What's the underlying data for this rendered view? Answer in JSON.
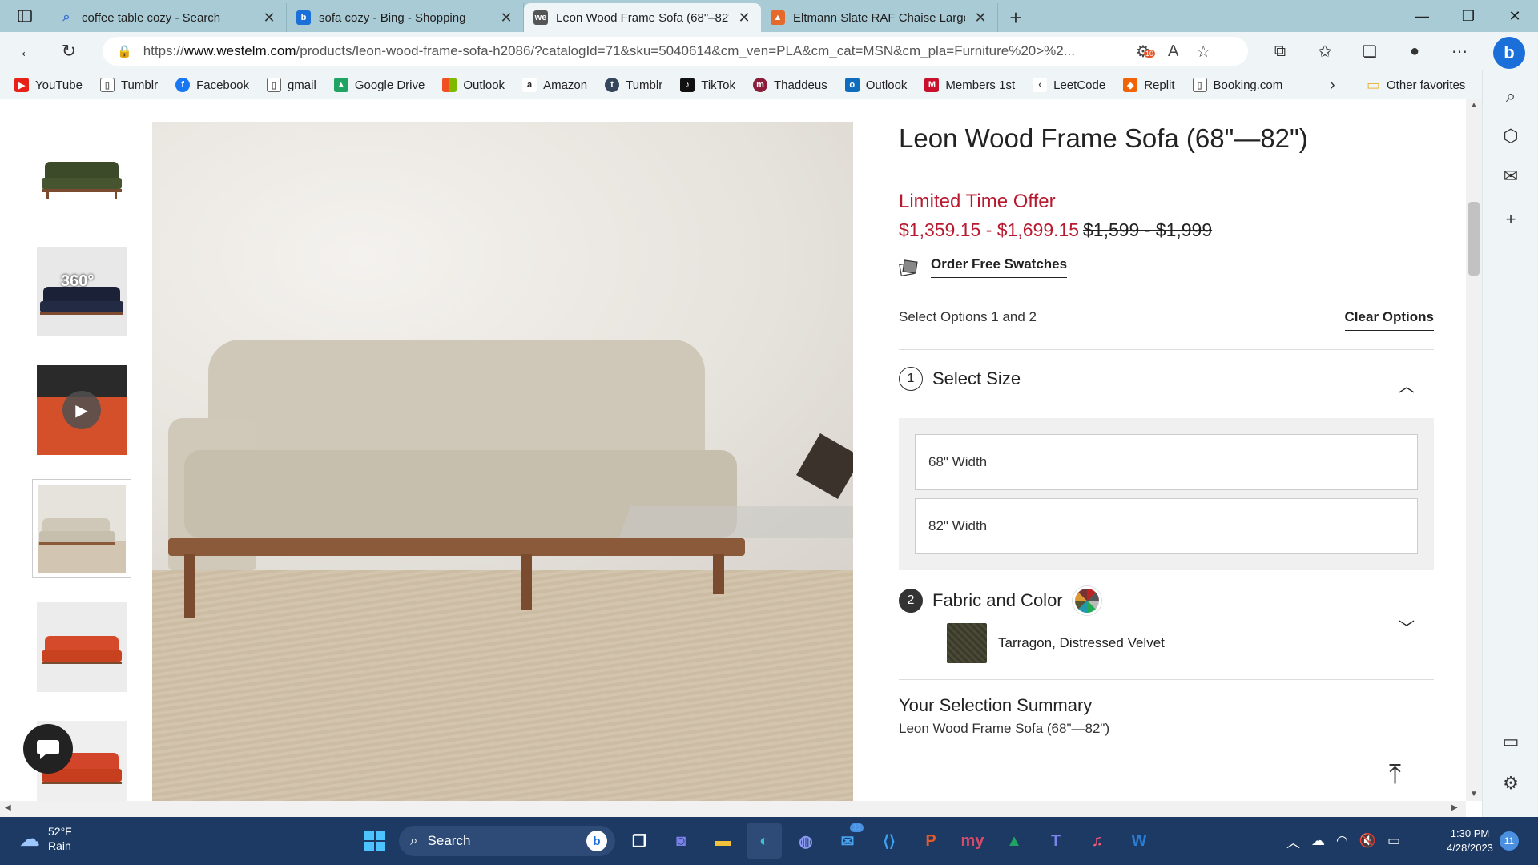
{
  "browser": {
    "tabs": [
      {
        "title": "coffee table cozy - Search",
        "icon": "search-icon",
        "color": "#3b6fd0"
      },
      {
        "title": "sofa cozy - Bing - Shopping",
        "icon": "bing-icon",
        "color": "#1b6fd8"
      },
      {
        "title": "Leon Wood Frame Sofa (68\"–82\"",
        "icon": "we-icon",
        "favtext": "we",
        "color": "#555555"
      },
      {
        "title": "Eltmann Slate RAF Chaise Large S",
        "icon": "store-icon",
        "color": "#e4692a"
      }
    ],
    "url_prefix": "https://",
    "url_host": "www.westelm.com",
    "url_path": "/products/leon-wood-frame-sofa-h2086/?catalogId=71&sku=5040614&cm_ven=PLA&cm_cat=MSN&cm_pla=Furniture%20>%2...",
    "tracking_badge": "10",
    "bookmarks": [
      {
        "label": "YouTube",
        "icon": "youtube-icon",
        "color": "#e62117"
      },
      {
        "label": "Tumblr",
        "icon": "page-icon",
        "color": "#666666"
      },
      {
        "label": "Facebook",
        "icon": "facebook-icon",
        "color": "#1877f2"
      },
      {
        "label": "gmail",
        "icon": "page-icon",
        "color": "#666666"
      },
      {
        "label": "Google Drive",
        "icon": "drive-icon",
        "color": "#1fa463"
      },
      {
        "label": "Outlook",
        "icon": "windows-icon",
        "color": "#f25022"
      },
      {
        "label": "Amazon",
        "icon": "amazon-icon",
        "color": "#222222"
      },
      {
        "label": "Tumblr",
        "icon": "tumblr-icon",
        "color": "#36465d"
      },
      {
        "label": "TikTok",
        "icon": "tiktok-icon",
        "color": "#111111"
      },
      {
        "label": "Thaddeus",
        "icon": "my-icon",
        "color": "#8b1c3a"
      },
      {
        "label": "Outlook",
        "icon": "outlook-icon",
        "color": "#0f6cbd"
      },
      {
        "label": "Members 1st",
        "icon": "m-icon",
        "color": "#c8102e"
      },
      {
        "label": "LeetCode",
        "icon": "leetcode-icon",
        "color": "#444444"
      },
      {
        "label": "Replit",
        "icon": "replit-icon",
        "color": "#f26207"
      },
      {
        "label": "Booking.com",
        "icon": "page-icon",
        "color": "#666666"
      }
    ],
    "other_favorites": "Other favorites"
  },
  "product": {
    "title": "Leon Wood Frame Sofa (68\"—82\")",
    "offer": "Limited Time Offer",
    "price": "$1,359.15 - $1,699.15",
    "old_price": "$1,599 - $1,999",
    "swatches_link": "Order Free Swatches",
    "options_label": "Select Options 1 and 2",
    "clear_options": "Clear Options",
    "step1": {
      "num": "1",
      "label": "Select Size"
    },
    "sizes": [
      "68\" Width",
      "82\" Width"
    ],
    "step2": {
      "num": "2",
      "label": "Fabric and Color"
    },
    "fabric": "Tarragon, Distressed Velvet",
    "summary_title": "Your Selection Summary",
    "summary_item": "Leon Wood Frame Sofa (68\"—82\")",
    "thumb_360": "360°"
  },
  "taskbar": {
    "temp": "52°F",
    "condition": "Rain",
    "search": "Search",
    "mail_badge": "11",
    "time": "1:30 PM",
    "date": "4/28/2023",
    "notifications": "11"
  }
}
